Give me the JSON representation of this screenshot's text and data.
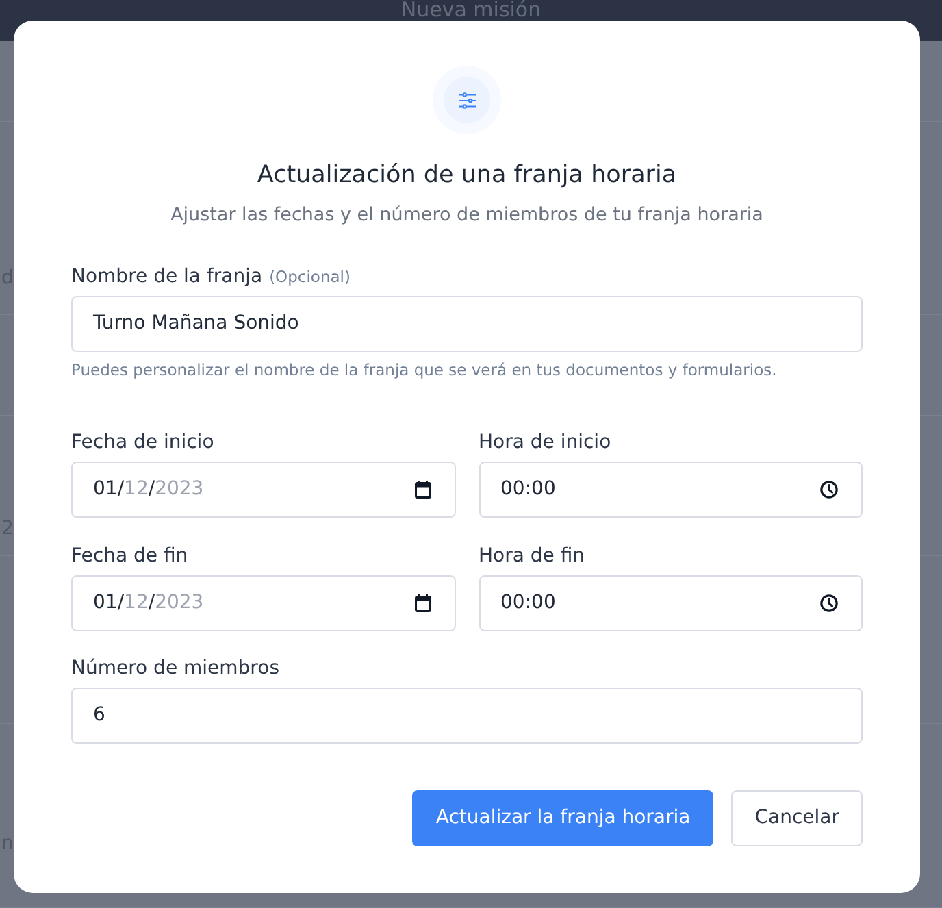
{
  "background": {
    "title": "Nueva misión",
    "edge_texts": [
      "d",
      "2",
      "n"
    ]
  },
  "dialog": {
    "title": "Actualización de una franja horaria",
    "subtitle": "Ajustar las fechas y el número de miembros de tu franja horaria",
    "name_field": {
      "label": "Nombre de la franja",
      "optional": "(Opcional)",
      "value": "Turno Mañana Sonido",
      "hint": "Puedes personalizar el nombre de la franja que se verá en tus documentos y formularios."
    },
    "time_fields": [
      {
        "kind": "date",
        "label": "Fecha de inicio",
        "parts": [
          {
            "text": "01/",
            "dim": false
          },
          {
            "text": "12",
            "dim": true
          },
          {
            "text": "/",
            "dim": false
          },
          {
            "text": "2023",
            "dim": true
          }
        ]
      },
      {
        "kind": "time",
        "label": "Hora de inicio",
        "value": "00:00"
      },
      {
        "kind": "date",
        "label": "Fecha de fin",
        "parts": [
          {
            "text": "01/",
            "dim": false
          },
          {
            "text": "12",
            "dim": true
          },
          {
            "text": "/",
            "dim": false
          },
          {
            "text": "2023",
            "dim": true
          }
        ]
      },
      {
        "kind": "time",
        "label": "Hora de fin",
        "value": "00:00"
      }
    ],
    "members_field": {
      "label": "Número de miembros",
      "value": "6"
    },
    "buttons": [
      {
        "kind": "primary",
        "label": "Actualizar la franja horaria"
      },
      {
        "kind": "secondary",
        "label": "Cancelar"
      }
    ]
  }
}
